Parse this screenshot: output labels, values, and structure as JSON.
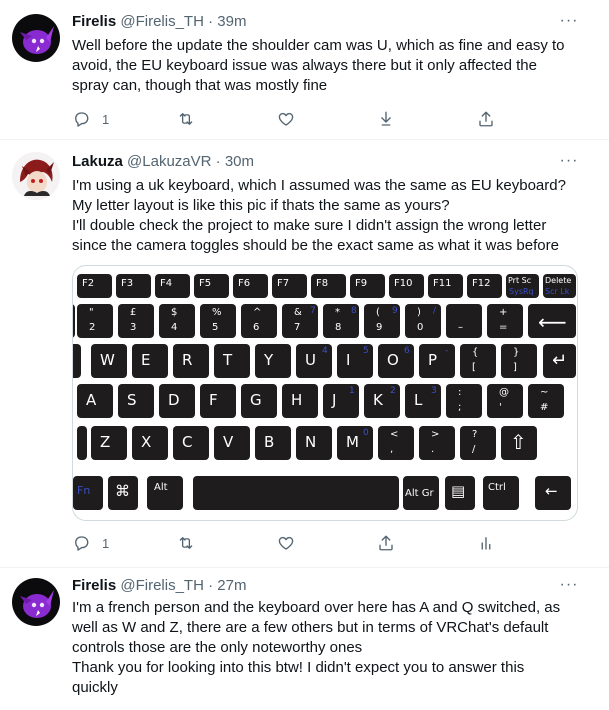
{
  "tweets": [
    {
      "name": "Firelis",
      "handle": "@Firelis_TH",
      "time": "39m",
      "text": [
        "Well before the update the shoulder cam was U, which as fine and easy to",
        "avoid, the EU keyboard issue was always there but it only affected the",
        "spray can, though that was mostly fine"
      ],
      "reply_count": "1"
    },
    {
      "name": "Lakuza",
      "handle": "@LakuzaVR",
      "time": "30m",
      "text": [
        "I'm using a uk keyboard, which I assumed was the same as EU keyboard?",
        "My letter layout is like this pic if thats the same as yours?",
        "I'll double check the project to make sure I didn't assign the wrong letter",
        "since the camera toggles should be the exact same as what it was before"
      ],
      "reply_count": "1"
    },
    {
      "name": "Firelis",
      "handle": "@Firelis_TH",
      "time": "27m",
      "text": [
        "I'm a french person and the keyboard over here has A and Q switched, as",
        "well as W and Z, there are a few others but in terms of VRChat's default",
        "controls those are the only noteworthy ones",
        "Thank you for looking into this btw! I didn't expect you to answer this",
        "quickly"
      ]
    }
  ],
  "separator": "·",
  "more_glyph": "···",
  "keyboard": {
    "fkeys": [
      "F2",
      "F3",
      "F4",
      "F5",
      "F6",
      "F7",
      "F8",
      "F9",
      "F10",
      "F11",
      "F12"
    ],
    "prtsc": [
      "Prt Sc",
      "SysRq"
    ],
    "delete": [
      "Delete",
      "Scr Lk"
    ],
    "numrow": [
      {
        "top": "\"",
        "bottom": "2"
      },
      {
        "top": "£",
        "bottom": "3"
      },
      {
        "top": "$",
        "bottom": "4"
      },
      {
        "top": "%",
        "bottom": "5"
      },
      {
        "top": "^",
        "bottom": "6"
      },
      {
        "top": "&",
        "bottom": "7",
        "alt": "7"
      },
      {
        "top": "*",
        "bottom": "8",
        "alt": "8"
      },
      {
        "top": "(",
        "bottom": "9",
        "alt": "9"
      },
      {
        "top": ")",
        "bottom": "0",
        "alt": "/"
      },
      {
        "top": "",
        "bottom": "–"
      },
      {
        "top": "+",
        "bottom": "="
      }
    ],
    "qrow": [
      "W",
      "E",
      "R",
      "T",
      "Y",
      "U",
      "I",
      "O",
      "P"
    ],
    "qrow_alt": {
      "U": "4",
      "I": "5",
      "O": "6",
      "P": "-"
    },
    "qrow_brackets": [
      [
        "{",
        "["
      ],
      [
        "}",
        "]"
      ]
    ],
    "arow": [
      "A",
      "S",
      "D",
      "F",
      "G",
      "H",
      "J",
      "K",
      "L"
    ],
    "arow_alt": {
      "J": "1",
      "K": "2",
      "L": "3"
    },
    "arow_extra": [
      [
        ":",
        ";"
      ],
      [
        "@",
        "'"
      ],
      [
        "~",
        "#"
      ]
    ],
    "zrow": [
      "Z",
      "X",
      "C",
      "V",
      "B",
      "N",
      "M"
    ],
    "zrow_alt": {
      "M": "0"
    },
    "zrow_extra": [
      [
        "<",
        ","
      ],
      [
        ">",
        "."
      ],
      [
        "?",
        "/"
      ]
    ],
    "bottom": {
      "fn": "Fn",
      "alt": "Alt",
      "altgr": "Alt Gr",
      "ctrl": "Ctrl"
    }
  }
}
